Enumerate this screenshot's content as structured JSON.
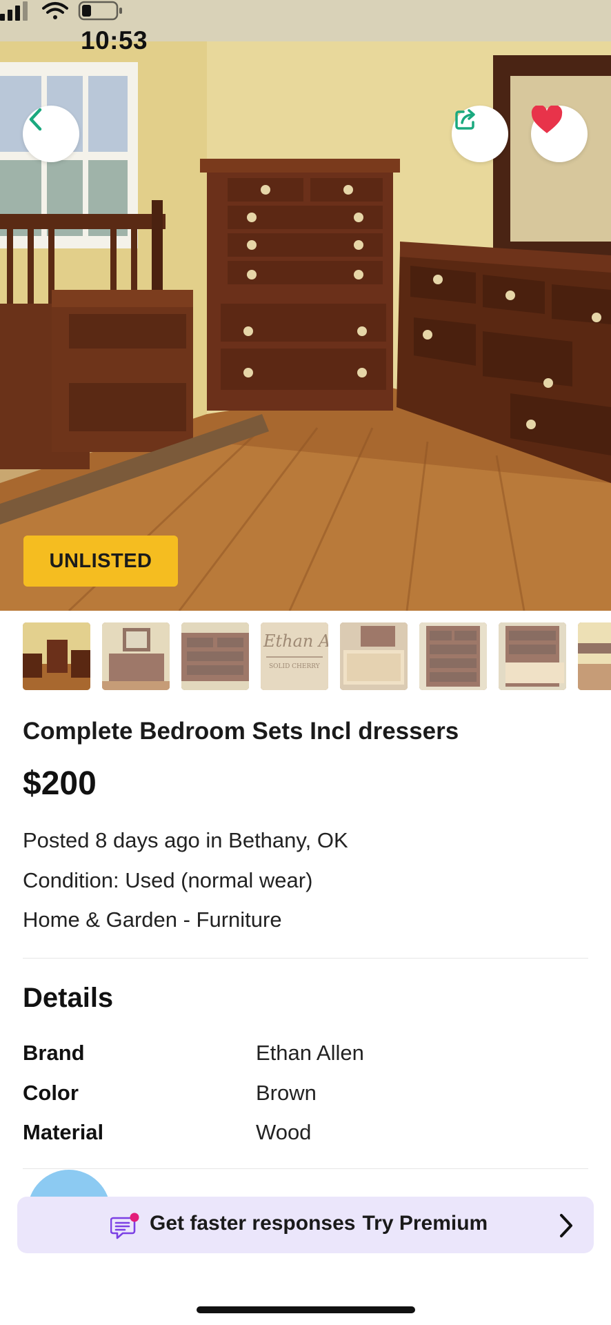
{
  "status_bar": {
    "time": "10:53"
  },
  "hero": {
    "badge": "UNLISTED",
    "actions": {
      "back_icon": "chevron-left-icon",
      "share_icon": "share-icon",
      "favorite_icon": "heart-icon",
      "favorite_color": "#e8334a",
      "accent_color": "#1ba97f"
    }
  },
  "thumbnails": {
    "count_visible": 8,
    "selected_index": 0
  },
  "listing": {
    "title": "Complete Bedroom Sets Incl dressers",
    "price": "$200",
    "posted": "Posted 8 days ago in Bethany, OK",
    "condition": "Condition: Used (normal wear)",
    "category": "Home & Garden - Furniture"
  },
  "details": {
    "heading": "Details",
    "rows": [
      {
        "label": "Brand",
        "value": "Ethan Allen"
      },
      {
        "label": "Color",
        "value": "Brown"
      },
      {
        "label": "Material",
        "value": "Wood"
      }
    ]
  },
  "premium_banner": {
    "text": "Get faster responses",
    "cta": "Try Premium",
    "background": "#ebe6fb",
    "icon": "message-icon"
  }
}
